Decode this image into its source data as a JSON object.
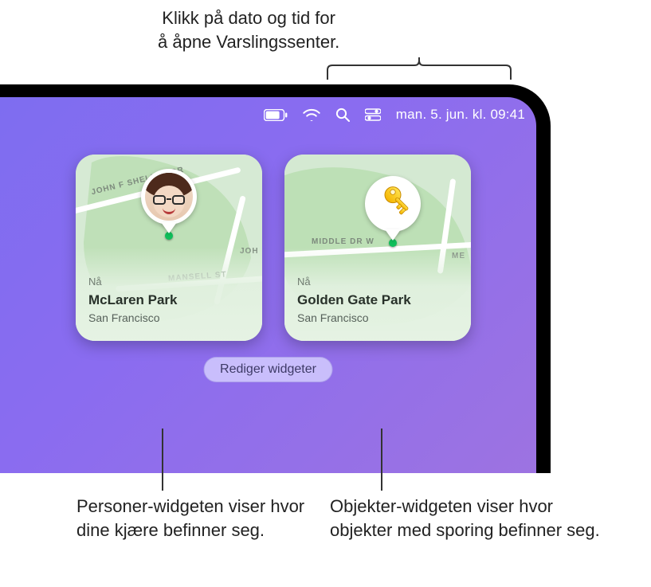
{
  "annotations": {
    "top_line1": "Klikk på dato og tid for",
    "top_line2": "å åpne Varslingssenter.",
    "bottom_left": "Personer-widgeten viser hvor dine kjære befinner seg.",
    "bottom_right": "Objekter-widgeten viser hvor objekter med sporing befinner seg."
  },
  "menubar": {
    "datetime": "man. 5. jun. kl. 09:41"
  },
  "widgets": {
    "people": {
      "now": "Nå",
      "title": "McLaren Park",
      "subtitle": "San Francisco",
      "roads": {
        "r1": "JOHN F SHELLEY DR",
        "r2": "MANSELL ST",
        "r3": "JOH"
      }
    },
    "items": {
      "now": "Nå",
      "title": "Golden Gate Park",
      "subtitle": "San Francisco",
      "roads": {
        "r1": "MIDDLE DR W",
        "r2": "ME"
      }
    }
  },
  "buttons": {
    "edit_widgets": "Rediger widgeter"
  }
}
